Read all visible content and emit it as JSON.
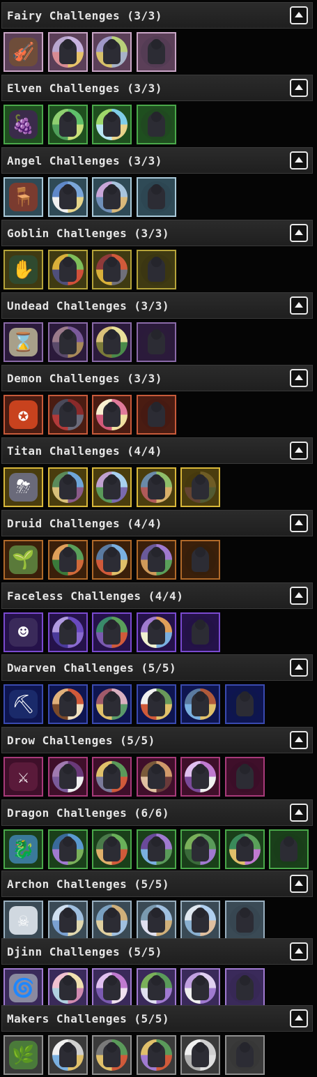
{
  "sections": [
    {
      "title": "Fairy Challenges (3/3)",
      "theme": {
        "border": "#c9a6c6",
        "bg": "#5b3f58",
        "accent": "#d8b0d0"
      },
      "tiles": [
        {
          "icon": "violin-icon",
          "art": "#6e4d3a",
          "glyph": "🎻"
        },
        {
          "icon": "fairy-silhouette-icon",
          "colors": [
            "#c9b4e0",
            "#e7c36a",
            "#d78b93",
            "#b9a7cf"
          ]
        },
        {
          "icon": "fairy-silhouette-icon",
          "colors": [
            "#b9d07a",
            "#a7b3c8",
            "#d7c06a",
            "#9f98c7"
          ]
        },
        {
          "icon": "fairy-silhouette-icon",
          "faded": true,
          "colors": [
            "#3f344a",
            "#3f344a",
            "#3f344a",
            "#3f344a"
          ]
        }
      ]
    },
    {
      "title": "Elven Challenges (3/3)",
      "theme": {
        "border": "#4aa84a",
        "bg": "#1f4f1f",
        "accent": "#7ad06a"
      },
      "tiles": [
        {
          "icon": "grapes-icon",
          "art": "#3a2b4a",
          "glyph": "🍇"
        },
        {
          "icon": "elf-silhouette-icon",
          "colors": [
            "#5fbf6a",
            "#c9e07a",
            "#4f9f5a",
            "#8fcf70"
          ]
        },
        {
          "icon": "elf-silhouette-icon",
          "colors": [
            "#7fcde8",
            "#e9d38a",
            "#b9e6f2",
            "#9fd86a"
          ]
        },
        {
          "icon": "elf-silhouette-icon",
          "faded": true,
          "colors": [
            "#233823",
            "#233823",
            "#233823",
            "#233823"
          ]
        }
      ]
    },
    {
      "title": "Angel Challenges (3/3)",
      "theme": {
        "border": "#a9c9d9",
        "bg": "#2f4a56",
        "accent": "#d8eef7"
      },
      "tiles": [
        {
          "icon": "throne-icon",
          "art": "#7a3b2f",
          "glyph": "🪑"
        },
        {
          "icon": "angel-silhouette-icon",
          "colors": [
            "#7aa6d9",
            "#e6d58a",
            "#f0f0f0",
            "#5f88c9"
          ]
        },
        {
          "icon": "angel-silhouette-icon",
          "colors": [
            "#a8c4dd",
            "#d9b97a",
            "#6f8fb9",
            "#c9a6d9"
          ]
        },
        {
          "icon": "angel-silhouette-icon",
          "faded": true,
          "colors": [
            "#263844",
            "#263844",
            "#263844",
            "#263844"
          ]
        }
      ]
    },
    {
      "title": "Goblin Challenges (3/3)",
      "theme": {
        "border": "#b6a43a",
        "bg": "#3f3a12",
        "accent": "#d9c44a"
      },
      "tiles": [
        {
          "icon": "goblin-hand-icon",
          "art": "#2f4a2f",
          "glyph": "✋"
        },
        {
          "icon": "goblin-silhouette-icon",
          "colors": [
            "#7fbf5a",
            "#d0503a",
            "#4f4f7a",
            "#d9b03a"
          ]
        },
        {
          "icon": "goblin-silhouette-icon",
          "colors": [
            "#d05a3a",
            "#6f6f7a",
            "#d9b03a",
            "#8f3a3a"
          ]
        },
        {
          "icon": "goblin-silhouette-icon",
          "faded": true,
          "colors": [
            "#2e2a10",
            "#2e2a10",
            "#2e2a10",
            "#2e2a10"
          ]
        }
      ]
    },
    {
      "title": "Undead Challenges (3/3)",
      "theme": {
        "border": "#8a6aa8",
        "bg": "#2b1a3b",
        "accent": "#b58ad8"
      },
      "tiles": [
        {
          "icon": "hourglass-icon",
          "art": "#a8a08a",
          "glyph": "⌛"
        },
        {
          "icon": "undead-silhouette-icon",
          "colors": [
            "#7a5a9a",
            "#a88a5a",
            "#5a4a6a",
            "#9a7a8a"
          ]
        },
        {
          "icon": "undead-silhouette-icon",
          "colors": [
            "#e9e09a",
            "#4a8a4a",
            "#7a7a3a",
            "#d9c07a"
          ]
        },
        {
          "icon": "undead-silhouette-icon",
          "faded": true,
          "colors": [
            "#2a1d35",
            "#2a1d35",
            "#2a1d35",
            "#2a1d35"
          ]
        }
      ]
    },
    {
      "title": "Demon Challenges (3/3)",
      "theme": {
        "border": "#c85a3a",
        "bg": "#4a1c12",
        "accent": "#f07a4a"
      },
      "tiles": [
        {
          "icon": "pentagram-icon",
          "art": "#c8421e",
          "glyph": "✪"
        },
        {
          "icon": "demon-silhouette-icon",
          "colors": [
            "#8a2a2a",
            "#6a6a7a",
            "#b03a3a",
            "#4a4a5a"
          ]
        },
        {
          "icon": "demon-silhouette-icon",
          "colors": [
            "#e07a9a",
            "#f0e0a0",
            "#d05a7a",
            "#f8f0d0"
          ]
        },
        {
          "icon": "demon-silhouette-icon",
          "faded": true,
          "colors": [
            "#3a1410",
            "#3a1410",
            "#3a1410",
            "#3a1410"
          ]
        }
      ]
    },
    {
      "title": "Titan Challenges (4/4)",
      "theme": {
        "border": "#d9b83a",
        "bg": "#4a3d0e",
        "accent": "#f0d25a"
      },
      "tiles": [
        {
          "icon": "storm-cloud-icon",
          "art": "#6a6a7a",
          "glyph": "⛈"
        },
        {
          "icon": "titan-silhouette-icon",
          "colors": [
            "#6fa6d9",
            "#8a5a8a",
            "#d9c07a",
            "#5a8a5a"
          ]
        },
        {
          "icon": "titan-silhouette-icon",
          "colors": [
            "#a8d0f0",
            "#7a6ab0",
            "#5a9a5a",
            "#c0a0d0"
          ]
        },
        {
          "icon": "titan-silhouette-icon",
          "colors": [
            "#8fbf6a",
            "#d9b06a",
            "#b05a5a",
            "#6a8aa8"
          ]
        },
        {
          "icon": "titan-silhouette-icon",
          "faded": true,
          "colors": [
            "#d9b86a",
            "#6ab0a0",
            "#b05aa0",
            "#3a2e0a"
          ]
        }
      ]
    },
    {
      "title": "Druid Challenges (4/4)",
      "theme": {
        "border": "#b06a2a",
        "bg": "#3a1f0a",
        "accent": "#d08a3a"
      },
      "tiles": [
        {
          "icon": "seed-icon",
          "art": "#5a7a3a",
          "glyph": "🌱"
        },
        {
          "icon": "druid-silhouette-icon",
          "colors": [
            "#5aa05a",
            "#d06a3a",
            "#3a7a3a",
            "#e0a05a"
          ]
        },
        {
          "icon": "druid-silhouette-icon",
          "colors": [
            "#7ab0e0",
            "#e0c06a",
            "#d05a3a",
            "#5a7aa0"
          ]
        },
        {
          "icon": "druid-silhouette-icon",
          "colors": [
            "#a07ad0",
            "#5aa05a",
            "#d09a5a",
            "#6a5a9a"
          ]
        },
        {
          "icon": "druid-silhouette-icon",
          "faded": true,
          "colors": [
            "#2a1a0a",
            "#2a1a0a",
            "#2a1a0a",
            "#2a1a0a"
          ]
        }
      ]
    },
    {
      "title": "Faceless Challenges (4/4)",
      "theme": {
        "border": "#7a4ad0",
        "bg": "#25124a",
        "accent": "#a07af0"
      },
      "tiles": [
        {
          "icon": "faceless-head-icon",
          "art": "#3a2a5a",
          "glyph": "☻"
        },
        {
          "icon": "faceless-silhouette-icon",
          "colors": [
            "#6a4ac0",
            "#8a6ad0",
            "#4a3a9a",
            "#b09ae0"
          ]
        },
        {
          "icon": "faceless-silhouette-icon",
          "colors": [
            "#5aa05a",
            "#d05a3a",
            "#7a5ab0",
            "#3a8a6a"
          ]
        },
        {
          "icon": "faceless-silhouette-icon",
          "colors": [
            "#e0a05a",
            "#7ab0e0",
            "#f0f0d0",
            "#a07ad0"
          ]
        },
        {
          "icon": "faceless-silhouette-icon",
          "faded": true,
          "colors": [
            "#1e103a",
            "#1e103a",
            "#1e103a",
            "#1e103a"
          ]
        }
      ]
    },
    {
      "title": "Dwarven Challenges (5/5)",
      "theme": {
        "border": "#3a4ab0",
        "bg": "#0e1550",
        "accent": "#5a6ae0"
      },
      "tiles": [
        {
          "icon": "pickaxe-icon",
          "art": "#1a2a6a",
          "glyph": "⛏"
        },
        {
          "icon": "dwarf-silhouette-icon",
          "colors": [
            "#d05a3a",
            "#f0e0c0",
            "#7a4a2a",
            "#e0b07a"
          ]
        },
        {
          "icon": "dwarf-silhouette-icon",
          "colors": [
            "#d9b0c0",
            "#5a9a6a",
            "#e0c06a",
            "#a05a6a"
          ]
        },
        {
          "icon": "dwarf-silhouette-icon",
          "colors": [
            "#6a9a5a",
            "#e0c06a",
            "#d05a3a",
            "#f0f0f0"
          ]
        },
        {
          "icon": "dwarf-silhouette-icon",
          "colors": [
            "#b05a3a",
            "#e0c06a",
            "#7ab0e0",
            "#5a7aa0"
          ]
        },
        {
          "icon": "dwarf-silhouette-icon",
          "faded": true,
          "colors": [
            "#10183f",
            "#10183f",
            "#10183f",
            "#10183f"
          ]
        }
      ]
    },
    {
      "title": "Drow Challenges (5/5)",
      "theme": {
        "border": "#a83a7a",
        "bg": "#3f0f2a",
        "accent": "#d05aa0"
      },
      "tiles": [
        {
          "icon": "crossed-blades-icon",
          "art": "#5a1a3a",
          "glyph": "⚔"
        },
        {
          "icon": "drow-silhouette-icon",
          "colors": [
            "#6a3a7a",
            "#f0f0f0",
            "#7a5a9a",
            "#a07ab0"
          ]
        },
        {
          "icon": "drow-silhouette-icon",
          "colors": [
            "#5a9a5a",
            "#d05a3a",
            "#7a7a9a",
            "#e0c06a"
          ]
        },
        {
          "icon": "drow-silhouette-icon",
          "colors": [
            "#d09a6a",
            "#6a3a3a",
            "#e0c0a0",
            "#7a5a3a"
          ]
        },
        {
          "icon": "drow-silhouette-icon",
          "colors": [
            "#c07ad0",
            "#f0f0f0",
            "#7a4a9a",
            "#e0c0f0"
          ]
        },
        {
          "icon": "drow-silhouette-icon",
          "faded": true,
          "colors": [
            "#300c22",
            "#300c22",
            "#300c22",
            "#300c22"
          ]
        }
      ]
    },
    {
      "title": "Dragon Challenges (6/6)",
      "theme": {
        "border": "#4aa84a",
        "bg": "#1a3f1a",
        "accent": "#7ad06a"
      },
      "tiles": [
        {
          "icon": "dragon-egg-icon",
          "art": "#3a7a9a",
          "glyph": "🐉"
        },
        {
          "icon": "dragon-silhouette-icon",
          "colors": [
            "#5a9ad0",
            "#7ab05a",
            "#a07ad0",
            "#3a6a9a"
          ]
        },
        {
          "icon": "dragon-silhouette-icon",
          "colors": [
            "#6ab05a",
            "#d05a3a",
            "#e0b06a",
            "#4a7a4a"
          ]
        },
        {
          "icon": "dragon-silhouette-icon",
          "colors": [
            "#a07ad0",
            "#5a9a5a",
            "#7ab0e0",
            "#6a4a9a"
          ]
        },
        {
          "icon": "dragon-silhouette-icon",
          "colors": [
            "#5a9a5a",
            "#a07ad0",
            "#3a6a3a",
            "#7ab05a"
          ]
        },
        {
          "icon": "dragon-silhouette-icon",
          "colors": [
            "#5aa05a",
            "#c07ad0",
            "#e0c06a",
            "#3a8a5a"
          ]
        },
        {
          "icon": "dragon-silhouette-icon",
          "faded": true,
          "colors": [
            "#173617",
            "#173617",
            "#173617",
            "#173617"
          ]
        }
      ]
    },
    {
      "title": "Archon Challenges (5/5)",
      "theme": {
        "border": "#9ab0c0",
        "bg": "#3a4a55",
        "accent": "#cfe0ea"
      },
      "tiles": [
        {
          "icon": "archon-skull-icon",
          "art": "#d0d8e0",
          "glyph": "☠"
        },
        {
          "icon": "archon-silhouette-icon",
          "colors": [
            "#a0c0e0",
            "#e0d8b0",
            "#7aa0d0",
            "#d0e0f0"
          ]
        },
        {
          "icon": "archon-silhouette-icon",
          "colors": [
            "#d0b07a",
            "#a0c0e0",
            "#e0d0a0",
            "#7aa0c0"
          ]
        },
        {
          "icon": "archon-silhouette-icon",
          "colors": [
            "#a0c0e0",
            "#d0b07a",
            "#e0e0f0",
            "#7a9ab0"
          ]
        },
        {
          "icon": "archon-silhouette-icon",
          "colors": [
            "#b0d0f0",
            "#e0c0a0",
            "#8ab0d0",
            "#e0e8f0"
          ]
        },
        {
          "icon": "archon-silhouette-icon",
          "faded": true,
          "colors": [
            "#2e3a44",
            "#2e3a44",
            "#2e3a44",
            "#2e3a44"
          ]
        }
      ]
    },
    {
      "title": "Djinn Challenges (5/5)",
      "theme": {
        "border": "#a07ad0",
        "bg": "#3a2a5a",
        "accent": "#c8a8f0"
      },
      "tiles": [
        {
          "icon": "djinn-lamp-icon",
          "art": "#8a8aa0",
          "glyph": "🌀"
        },
        {
          "icon": "djinn-silhouette-icon",
          "colors": [
            "#f0e0b0",
            "#d08ab0",
            "#b0d0e0",
            "#f0c0d0"
          ]
        },
        {
          "icon": "djinn-silhouette-icon",
          "colors": [
            "#c07ad0",
            "#f0e0f0",
            "#7a5ab0",
            "#e0c0f0"
          ]
        },
        {
          "icon": "djinn-silhouette-icon",
          "colors": [
            "#5a9a5a",
            "#a07ad0",
            "#e0e0f0",
            "#7ab05a"
          ]
        },
        {
          "icon": "djinn-silhouette-icon",
          "colors": [
            "#e0d0f0",
            "#a07ad0",
            "#f0f0f0",
            "#c0a0e0"
          ]
        },
        {
          "icon": "djinn-silhouette-icon",
          "faded": true,
          "colors": [
            "#2e2046",
            "#2e2046",
            "#2e2046",
            "#2e2046"
          ]
        }
      ]
    },
    {
      "title": "Makers Challenges (5/5)",
      "theme": {
        "border": "#909090",
        "bg": "#3a3a3a",
        "accent": "#d0d0d0"
      },
      "tiles": [
        {
          "icon": "makers-orb-icon",
          "art": "#4a7a3a",
          "glyph": "🌿"
        },
        {
          "icon": "maker-silhouette-icon",
          "colors": [
            "#d0d0d0",
            "#e0c06a",
            "#7ab0e0",
            "#f0f0f0"
          ]
        },
        {
          "icon": "maker-silhouette-icon",
          "colors": [
            "#5a9a5a",
            "#d05a3a",
            "#e0c06a",
            "#7a7a7a"
          ]
        },
        {
          "icon": "maker-silhouette-icon",
          "colors": [
            "#5a9a5a",
            "#d05a3a",
            "#a07ad0",
            "#e0c06a"
          ]
        },
        {
          "icon": "maker-silhouette-icon",
          "colors": [
            "#d0d0d0",
            "#e0e0e0",
            "#b0b0b0",
            "#f0f0f0"
          ]
        },
        {
          "icon": "maker-silhouette-icon",
          "faded": true,
          "colors": [
            "#2e2e2e",
            "#2e2e2e",
            "#2e2e2e",
            "#2e2e2e"
          ]
        }
      ]
    }
  ]
}
